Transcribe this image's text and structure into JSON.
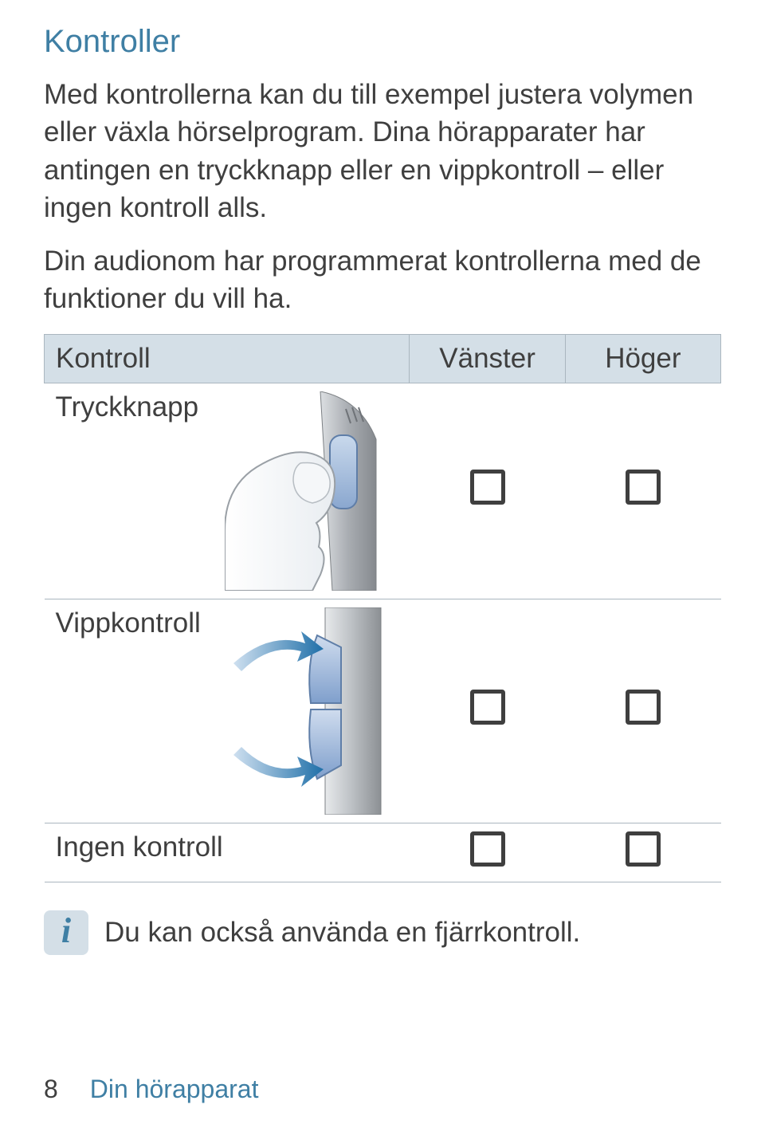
{
  "title": "Kontroller",
  "paragraphs": {
    "p1": "Med kontrollerna kan du till exempel justera volymen eller växla hörselprogram. Dina hörapparater har antingen en tryckknapp eller en vippkontroll – eller ingen kontroll alls.",
    "p2": "Din audionom har programmerat kontrollerna med de funktioner du vill ha."
  },
  "table": {
    "headers": {
      "control": "Kontroll",
      "left": "Vänster",
      "right": "Höger"
    },
    "rows": {
      "push": {
        "label": "Tryckknapp"
      },
      "rocker": {
        "label": "Vippkontroll"
      },
      "none": {
        "label": "Ingen kontroll"
      }
    }
  },
  "info": {
    "text": "Du kan också använda en fjärrkontroll."
  },
  "footer": {
    "page": "8",
    "section": "Din hörapparat"
  }
}
